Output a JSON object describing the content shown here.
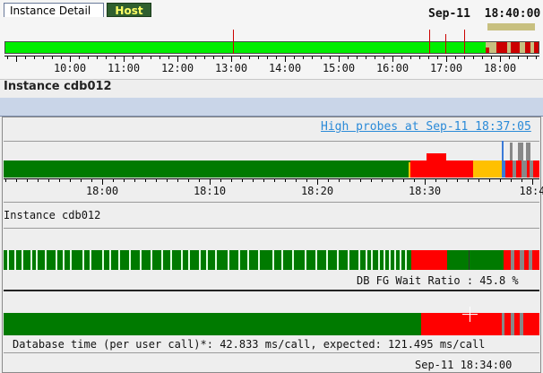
{
  "top_timeline": {
    "timestamp": "Sep-11  18:40:00",
    "axis_labels": [
      "10:00",
      "11:00",
      "12:00",
      "13:00",
      "14:00",
      "15:00",
      "16:00",
      "17:00",
      "18:00"
    ]
  },
  "instance_title": "Instance cdb012",
  "tabs": [
    {
      "label": "Instance Detail",
      "active": true
    },
    {
      "label": "Host",
      "active": false
    }
  ],
  "detail": {
    "probe_link": "High probes at Sep-11 18:37:05",
    "axis_labels": [
      "18:00",
      "18:10",
      "18:20",
      "18:30",
      "18:4"
    ],
    "instance_label": "Instance cdb012",
    "fg_wait_label": "DB FG Wait Ratio : 45.8 %",
    "db_time_label": "Database time (per user call)*: 42.833 ms/call, expected: 121.495 ms/call",
    "cursor_time": "Sep-11 18:34:00"
  },
  "colors": {
    "normal": "#00ee00",
    "ok": "#007a00",
    "warn": "#ffc000",
    "critical": "#ff0000",
    "no_data": "#888888",
    "highlight": "#c8c080",
    "link": "#2a8ad8"
  }
}
